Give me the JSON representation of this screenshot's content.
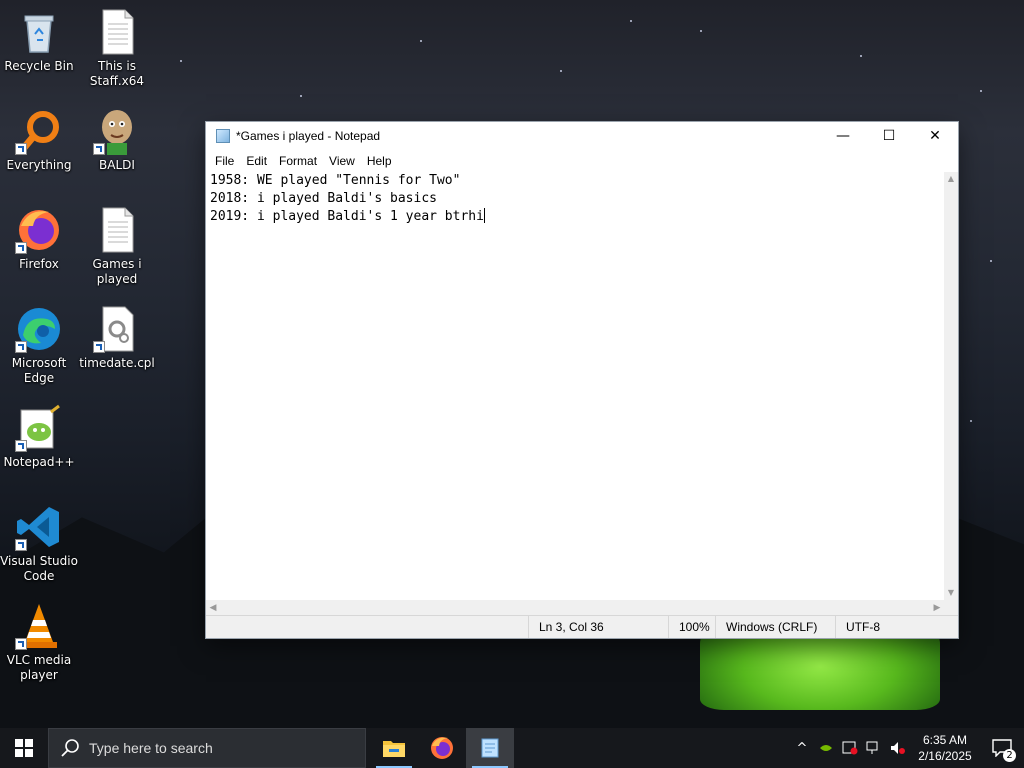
{
  "desktop": {
    "icons": [
      {
        "label": "Recycle Bin"
      },
      {
        "label": "This is Staff.x64"
      },
      {
        "label": "Everything"
      },
      {
        "label": "BALDI"
      },
      {
        "label": "Firefox"
      },
      {
        "label": "Games i played"
      },
      {
        "label": "Microsoft Edge"
      },
      {
        "label": "timedate.cpl"
      },
      {
        "label": "Notepad++"
      },
      {
        "label": "Visual Studio Code"
      },
      {
        "label": "VLC media player"
      }
    ]
  },
  "notepad": {
    "title": "*Games i played - Notepad",
    "controls": {
      "minimize": "—",
      "maximize": "☐",
      "close": "✕"
    },
    "menu": [
      "File",
      "Edit",
      "Format",
      "View",
      "Help"
    ],
    "lines": [
      "1958: WE played \"Tennis for Two\"",
      "2018: i played Baldi's basics",
      "2019: i played Baldi's 1 year btrhi"
    ],
    "status": {
      "position": "Ln 3, Col 36",
      "zoom": "100%",
      "line_ending": "Windows (CRLF)",
      "encoding": "UTF-8"
    }
  },
  "taskbar": {
    "search_placeholder": "Type here to search",
    "apps": [
      "File Explorer",
      "Firefox",
      "Notepad"
    ],
    "time": "6:35 AM",
    "date": "2/16/2025",
    "notification_count": "2"
  }
}
